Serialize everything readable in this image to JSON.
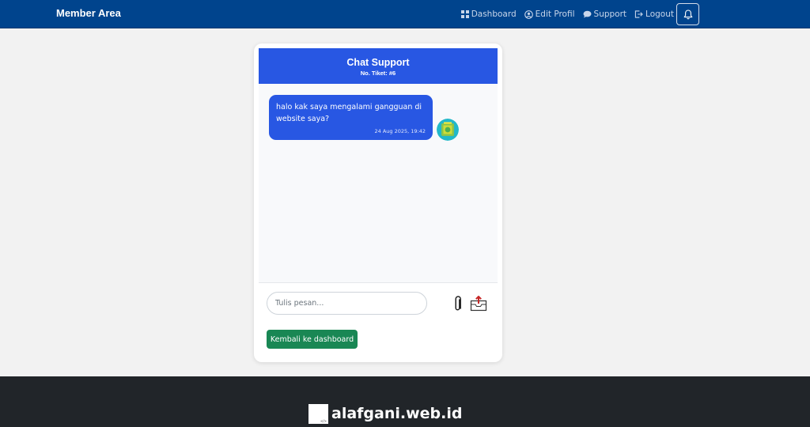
{
  "navbar": {
    "brand": "Member Area",
    "links": [
      {
        "label": "Dashboard",
        "icon": "grid-icon"
      },
      {
        "label": "Edit Profil",
        "icon": "user-circle-icon"
      },
      {
        "label": "Support",
        "icon": "chat-bubble-icon"
      },
      {
        "label": "Logout",
        "icon": "logout-icon"
      }
    ],
    "bell_icon": "bell-icon"
  },
  "chat": {
    "title": "Chat Support",
    "ticket": "No. Tiket: #6",
    "messages": [
      {
        "text": "halo kak saya mengalami gangguan di website saya?",
        "time": "24 Aug 2025, 19:42"
      }
    ]
  },
  "composer": {
    "placeholder": "Tulis pesan...",
    "attach_icon": "paperclip-icon",
    "send_icon": "inbox-upload-icon"
  },
  "back_button": "Kembali ke dashboard",
  "footer": {
    "logo_mark": "</>",
    "site_name": "alafgani.web.id"
  },
  "colors": {
    "navbar": "#00448d",
    "chat_header": "#2857e3",
    "bubble": "#2857e3",
    "back_button": "#198754",
    "footer": "#212529"
  }
}
